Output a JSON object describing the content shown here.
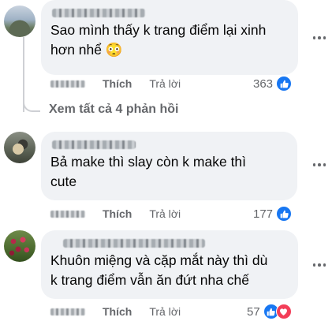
{
  "comments": [
    {
      "avatar": "landscape-photo",
      "text_lines": [
        "Sao mình thấy k trang điểm lại xinh",
        "hơn nhể 😳"
      ],
      "like_label": "Thích",
      "reply_label": "Trả lời",
      "reaction_count": "363",
      "reactions": [
        "like-icon"
      ]
    },
    {
      "avatar": "bird-photo",
      "text_lines": [
        "Bả make thì slay còn k make thì",
        "cute"
      ],
      "like_label": "Thích",
      "reply_label": "Trả lời",
      "reaction_count": "177",
      "reactions": [
        "like-icon"
      ]
    },
    {
      "avatar": "flowers-photo",
      "text_lines": [
        "Khuôn miệng và cặp mắt này thì dù",
        "k trang điểm vẫn ăn đứt nha chế"
      ],
      "like_label": "Thích",
      "reply_label": "Trả lời",
      "reaction_count": "57",
      "reactions": [
        "like-icon",
        "love-icon"
      ]
    }
  ],
  "view_replies": "Xem tất cả 4 phản hồi",
  "colors": {
    "bubble": "#f0f2f5",
    "secondary_text": "#65676b",
    "like_blue": "#1877f2",
    "love_red": "#f33e58"
  }
}
